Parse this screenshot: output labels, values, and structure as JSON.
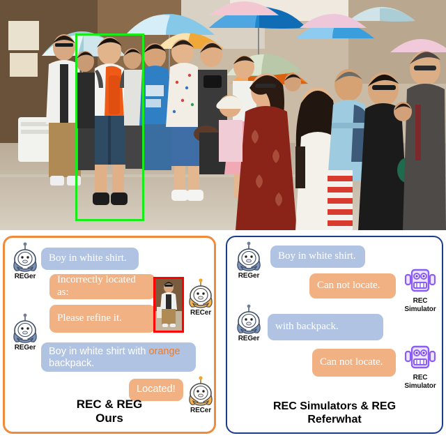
{
  "photo": {
    "alt": "Crowd of tourists with umbrellas on a sunny street",
    "bbox_color": "#19ec19",
    "bbox_label": "target-person-box"
  },
  "panels": {
    "ours": {
      "border_color": "#f08b3c",
      "caption_line1": "REC & REG",
      "caption_line2": "Ours",
      "avatars": {
        "reger1": "REGer",
        "reger2": "REGer",
        "recer1": "RECer",
        "recer2": "RECer"
      },
      "messages": [
        {
          "id": "m1",
          "speaker": "REGer",
          "side": "left",
          "style": "blue",
          "font": "serif",
          "text": "Boy in white shirt."
        },
        {
          "id": "m2",
          "speaker": "RECer",
          "side": "right",
          "style": "orange",
          "font": "serif",
          "text": "Incorrectly located as:"
        },
        {
          "id": "m3",
          "speaker": "RECer",
          "side": "right",
          "style": "orange",
          "font": "serif",
          "text": "Please refine it."
        },
        {
          "id": "m4",
          "speaker": "REGer",
          "side": "left",
          "style": "blue",
          "font": "sans",
          "text": "Boy in white shirt with ",
          "highlight": "orange",
          "text_after": " backpack."
        },
        {
          "id": "m5",
          "speaker": "RECer",
          "side": "right",
          "style": "orange",
          "font": "sans",
          "text": "Located!"
        }
      ],
      "crop_thumb": {
        "name": "incorrect-detection-crop",
        "border_color": "#ff0000"
      }
    },
    "referwhat": {
      "border_color": "#1b3d8f",
      "caption_line1": "REC Simulators & REG",
      "caption_line2": "Referwhat",
      "avatars": {
        "reger1": "REGer",
        "reger2": "REGer",
        "sim1_line1": "REC",
        "sim1_line2": "Simulator",
        "sim2_line1": "REC",
        "sim2_line2": "Simulator"
      },
      "messages": [
        {
          "id": "r1",
          "speaker": "REGer",
          "side": "left",
          "style": "blue",
          "font": "serif",
          "text": "Boy in white shirt."
        },
        {
          "id": "r2",
          "speaker": "REC Simulator",
          "side": "right",
          "style": "orange",
          "font": "serif",
          "text": "Can not locate."
        },
        {
          "id": "r3",
          "speaker": "REGer",
          "side": "left",
          "style": "blue",
          "font": "serif",
          "text": "with backpack."
        },
        {
          "id": "r4",
          "speaker": "REC Simulator",
          "side": "right",
          "style": "orange",
          "font": "serif",
          "text": "Can not locate."
        }
      ]
    }
  },
  "colors": {
    "bubble_blue": "#b1c3e2",
    "bubble_orange": "#f2b183",
    "bubble_text": "#ffffff",
    "highlight_orange": "#f07a20",
    "panel_orange": "#f08b3c",
    "panel_navy": "#1b3d8f",
    "bbox_green": "#19ec19",
    "crop_red": "#ff0000",
    "robot_purple": "#8b5cf6"
  }
}
